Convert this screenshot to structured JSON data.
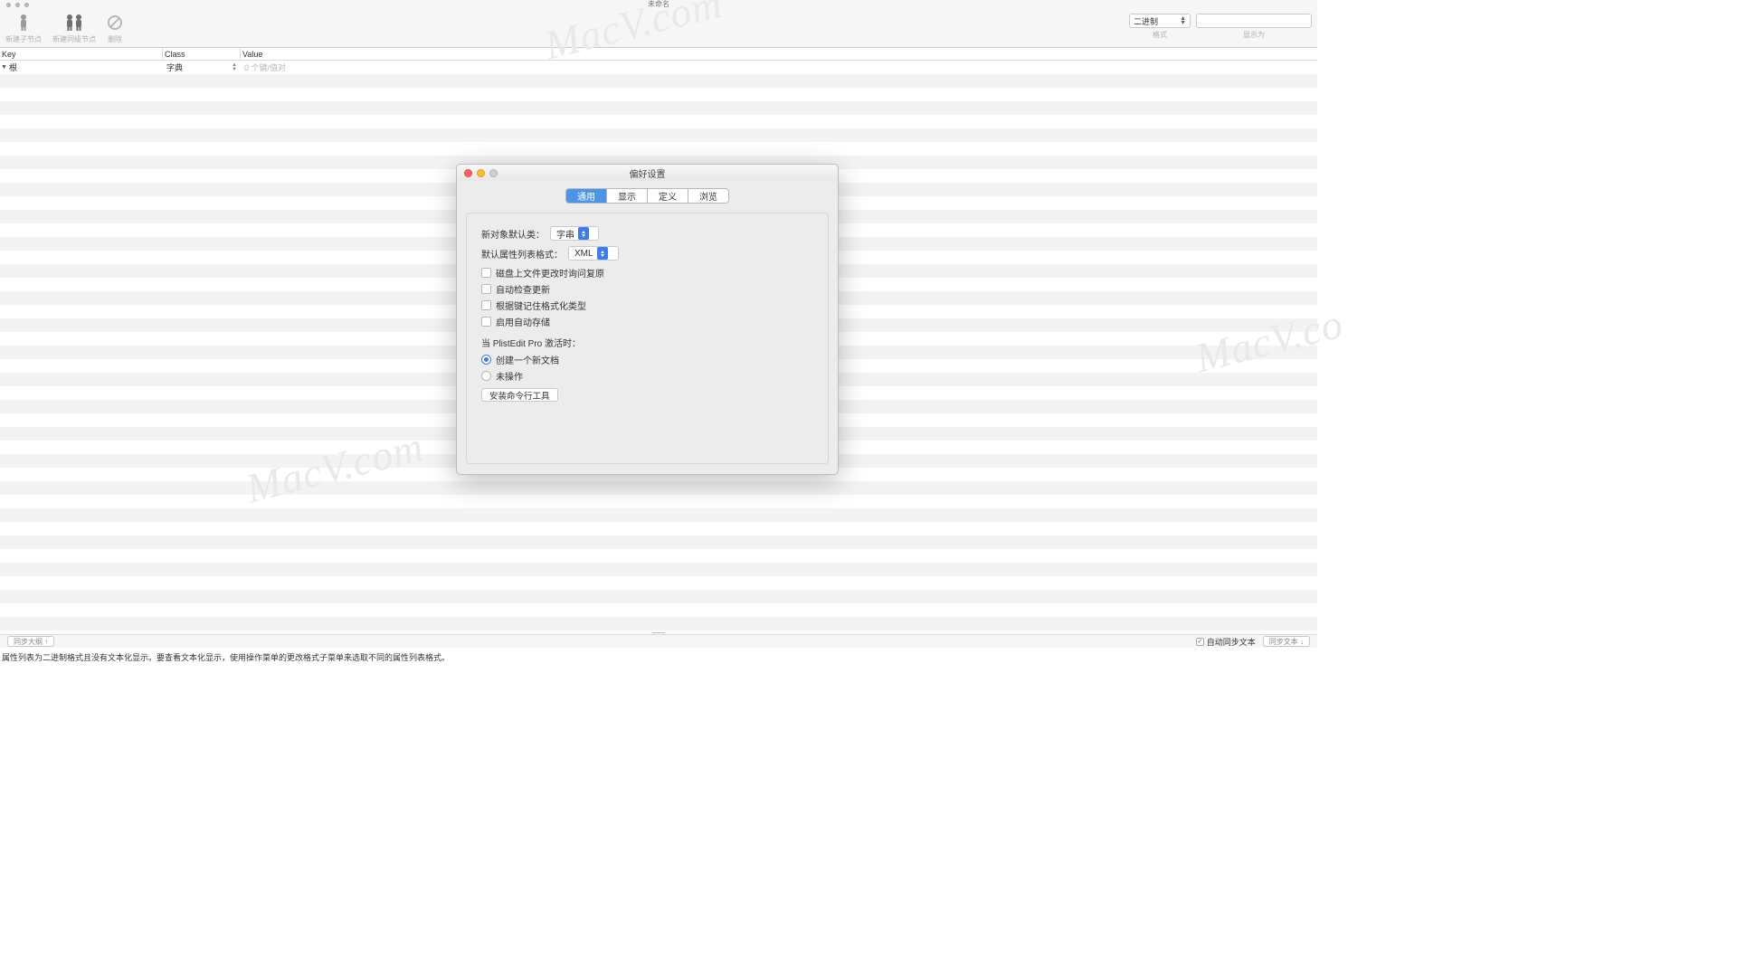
{
  "window": {
    "title": "未命名"
  },
  "toolbar": {
    "new_child": "新建子节点",
    "new_sibling": "新建同级节点",
    "delete": "删除",
    "format_select": "二进制",
    "format_label": "格式",
    "display_as_label": "显示为"
  },
  "columns": {
    "key": "Key",
    "class": "Class",
    "value": "Value"
  },
  "root_row": {
    "key": "根",
    "class": "字典",
    "value": "0 个键/值对"
  },
  "bottom": {
    "sync_outline": "同步大纲 ↑",
    "auto_sync": "自动同步文本",
    "sync_text": "同步文本 ↓"
  },
  "info": "属性列表为二进制格式且没有文本化显示。要查看文本化显示，使用操作菜单的更改格式子菜单来选取不同的属性列表格式。",
  "watermark": "MacV.com",
  "watermark_partial": "MacV.co",
  "prefs": {
    "title": "偏好设置",
    "tabs": {
      "general": "通用",
      "display": "显示",
      "definition": "定义",
      "browse": "浏览"
    },
    "default_class_label": "新对象默认类：",
    "default_class_value": "字串",
    "default_format_label": "默认属性列表格式：",
    "default_format_value": "XML",
    "chk_restore": "磁盘上文件更改时询问复原",
    "chk_update": "自动检查更新",
    "chk_format_by_key": "根据键记住格式化类型",
    "chk_autosave": "启用自动存储",
    "activate_label": "当 PlistEdit Pro 激活时：",
    "radio_new_doc": "创建一个新文档",
    "radio_noop": "未操作",
    "install_cli": "安装命令行工具"
  }
}
